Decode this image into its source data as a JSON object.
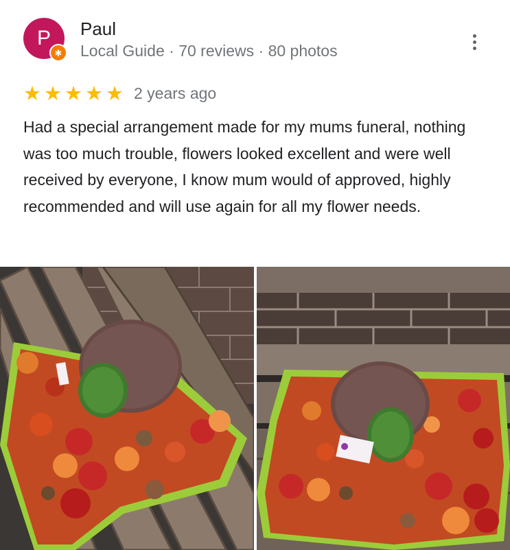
{
  "reviewer": {
    "avatar_letter": "P",
    "name": "Paul",
    "meta": "Local Guide · 70 reviews · 80 photos",
    "avatar_color": "#c2185b",
    "badge_color": "#f57c00"
  },
  "rating": {
    "stars": 5,
    "max_stars": 5,
    "star_color": "#fbbc04"
  },
  "time": "2 years ago",
  "review_text": "Had a special arrangement made for my mums funeral, nothing was too much trouble, flowers looked excellent and were well received by everyone, I know mum would of approved, highly recommended and will use again for all my flower needs.",
  "photos": [
    {
      "name": "funeral-arrangement-on-bench-photo"
    },
    {
      "name": "funeral-arrangement-against-brick-wall-photo"
    }
  ],
  "icons": {
    "more": "more-vert-icon",
    "badge": "local-guide-badge-icon",
    "star": "star-icon"
  }
}
